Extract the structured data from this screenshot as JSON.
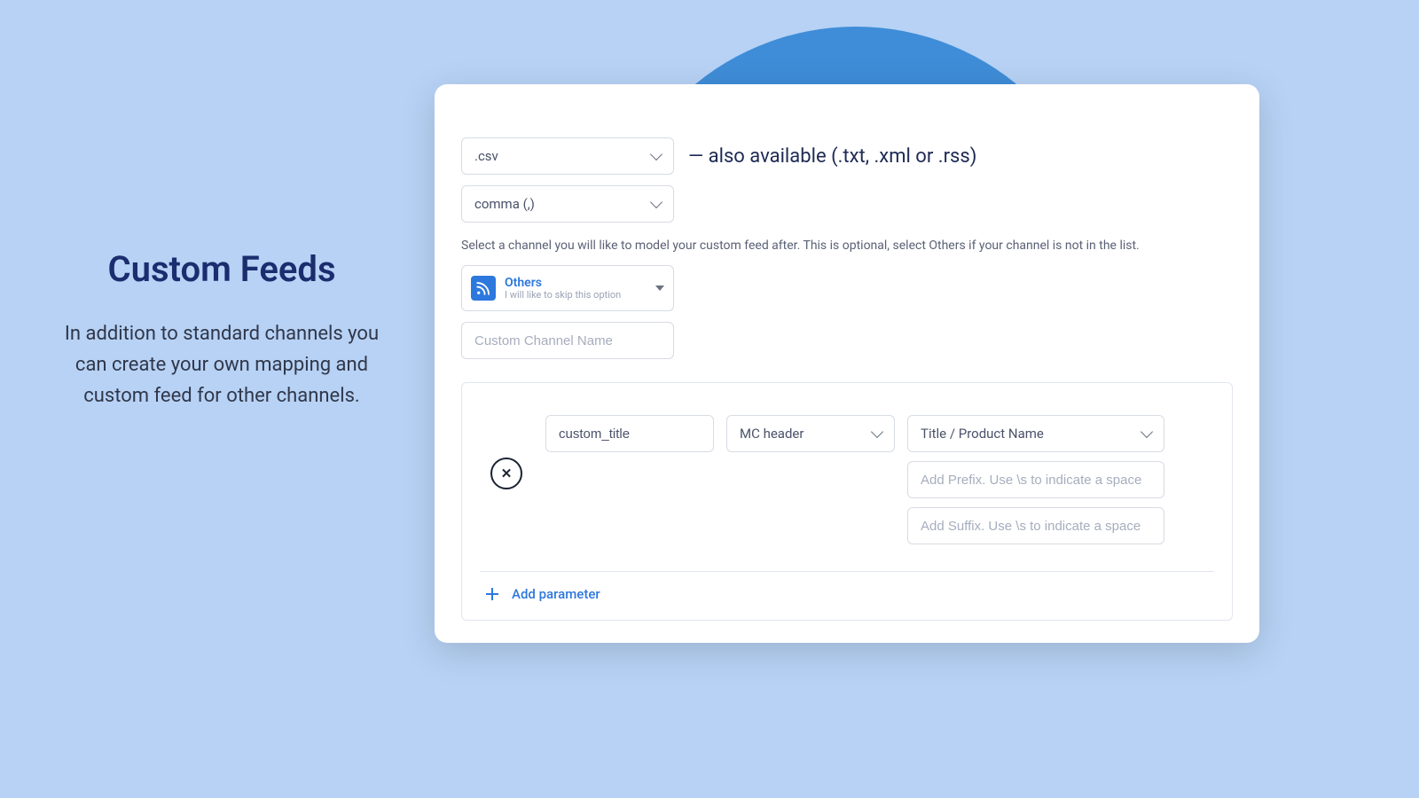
{
  "side": {
    "title": "Custom Feeds",
    "desc": "In addition to standard channels you can create your own mapping and custom feed for other channels."
  },
  "form": {
    "filetype": {
      "selected": ".csv",
      "note": "— also available (.txt, .xml or .rss)"
    },
    "delimiter": {
      "selected": "comma (,)"
    },
    "channel_helper": "Select a channel you will like to model your custom feed after. This is optional, select Others if your channel is not in the list.",
    "channel": {
      "title": "Others",
      "subtitle": "I will like to skip this option"
    },
    "custom_channel": {
      "placeholder": "Custom Channel Name",
      "value": ""
    }
  },
  "mapping": {
    "row": {
      "field_name": "custom_title",
      "header_select": "MC header",
      "value_select": "Title / Product Name",
      "prefix_placeholder": "Add Prefix. Use \\s to indicate a space",
      "suffix_placeholder": "Add Suffix. Use \\s to indicate a space"
    },
    "add_label": "Add parameter"
  }
}
